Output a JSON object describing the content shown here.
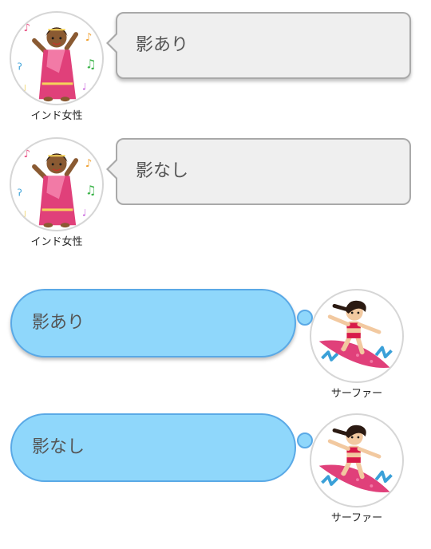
{
  "rows": [
    {
      "type": "speech",
      "avatar_name": "インド女性",
      "message": "影あり",
      "shadow": true,
      "avatar_icon": "indian-woman-icon"
    },
    {
      "type": "speech",
      "avatar_name": "インド女性",
      "message": "影なし",
      "shadow": false,
      "avatar_icon": "indian-woman-icon"
    },
    {
      "type": "thought",
      "avatar_name": "サーファー",
      "message": "影あり",
      "shadow": true,
      "avatar_icon": "surfer-icon"
    },
    {
      "type": "thought",
      "avatar_name": "サーファー",
      "message": "影なし",
      "shadow": false,
      "avatar_icon": "surfer-icon"
    }
  ],
  "colors": {
    "speech_bg": "#efefef",
    "speech_border": "#a9a9a9",
    "thought_bg": "#8fd7fb",
    "thought_border": "#5aa9e6",
    "text": "#555555"
  }
}
